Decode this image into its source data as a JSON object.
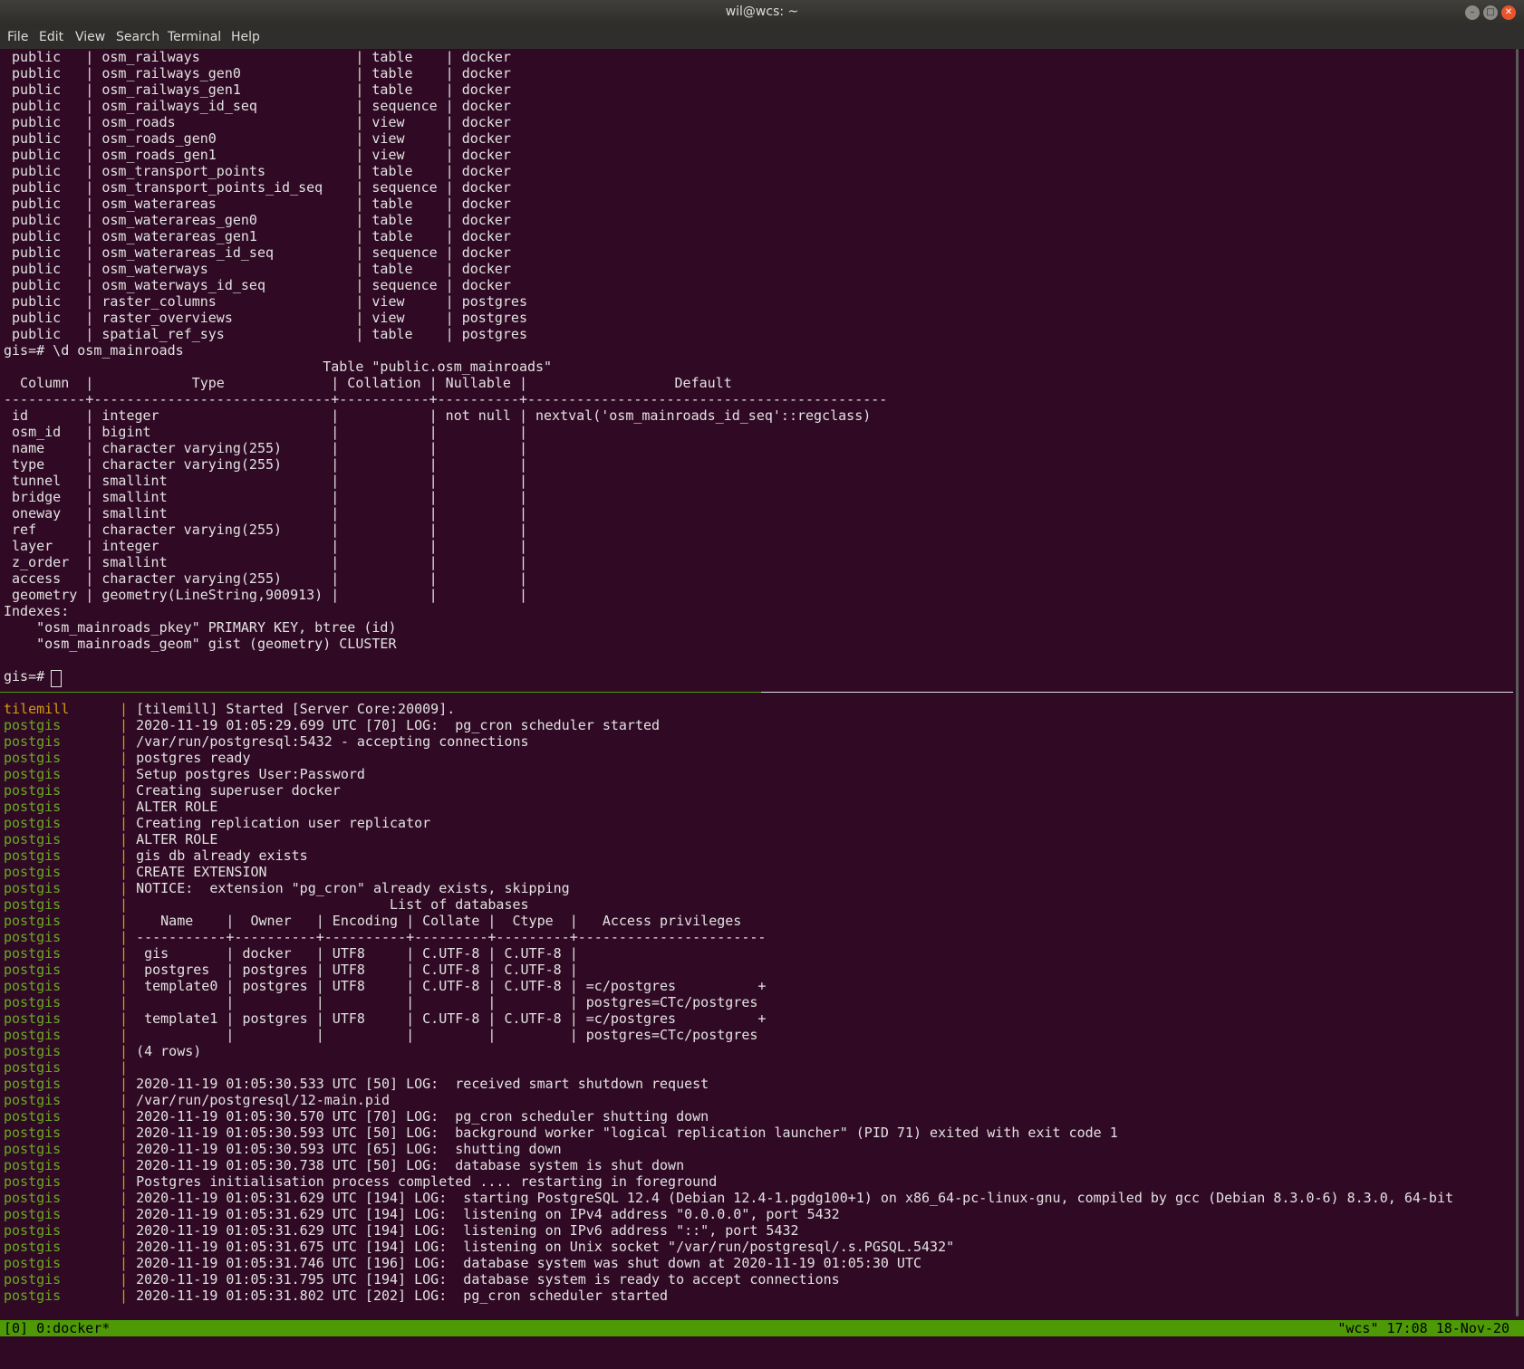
{
  "window": {
    "title": "wil@wcs: ~"
  },
  "menu": [
    "File",
    "Edit",
    "View",
    "Search",
    "Terminal",
    "Help"
  ],
  "top_pane": {
    "lines": [
      " public   | osm_railways                   | table    | docker",
      " public   | osm_railways_gen0              | table    | docker",
      " public   | osm_railways_gen1              | table    | docker",
      " public   | osm_railways_id_seq            | sequence | docker",
      " public   | osm_roads                      | view     | docker",
      " public   | osm_roads_gen0                 | view     | docker",
      " public   | osm_roads_gen1                 | view     | docker",
      " public   | osm_transport_points           | table    | docker",
      " public   | osm_transport_points_id_seq    | sequence | docker",
      " public   | osm_waterareas                 | table    | docker",
      " public   | osm_waterareas_gen0            | table    | docker",
      " public   | osm_waterareas_gen1            | table    | docker",
      " public   | osm_waterareas_id_seq          | sequence | docker",
      " public   | osm_waterways                  | table    | docker",
      " public   | osm_waterways_id_seq           | sequence | docker",
      " public   | raster_columns                 | view     | postgres",
      " public   | raster_overviews               | view     | postgres",
      " public   | spatial_ref_sys                | table    | postgres",
      "gis=# \\d osm_mainroads",
      "                                       Table \"public.osm_mainroads\"",
      "  Column  |            Type             | Collation | Nullable |                  Default",
      "----------+-----------------------------+-----------+----------+--------------------------------------------",
      " id       | integer                     |           | not null | nextval('osm_mainroads_id_seq'::regclass)",
      " osm_id   | bigint                      |           |          |",
      " name     | character varying(255)      |           |          |",
      " type     | character varying(255)      |           |          |",
      " tunnel   | smallint                    |           |          |",
      " bridge   | smallint                    |           |          |",
      " oneway   | smallint                    |           |          |",
      " ref      | character varying(255)      |           |          |",
      " layer    | integer                     |           |          |",
      " z_order  | smallint                    |           |          |",
      " access   | character varying(255)      |           |          |",
      " geometry | geometry(LineString,900913) |           |          |",
      "Indexes:",
      "    \"osm_mainroads_pkey\" PRIMARY KEY, btree (id)",
      "    \"osm_mainroads_geom\" gist (geometry) CLUSTER",
      "",
      "gis=# "
    ]
  },
  "bottom_pane": {
    "lines": [
      {
        "src": "tilemill",
        "msg": "[tilemill] Started [Server Core:20009]."
      },
      {
        "src": "postgis",
        "msg": "2020-11-19 01:05:29.699 UTC [70] LOG:  pg_cron scheduler started"
      },
      {
        "src": "postgis",
        "msg": "/var/run/postgresql:5432 - accepting connections"
      },
      {
        "src": "postgis",
        "msg": "postgres ready"
      },
      {
        "src": "postgis",
        "msg": "Setup postgres User:Password"
      },
      {
        "src": "postgis",
        "msg": "Creating superuser docker"
      },
      {
        "src": "postgis",
        "msg": "ALTER ROLE"
      },
      {
        "src": "postgis",
        "msg": "Creating replication user replicator"
      },
      {
        "src": "postgis",
        "msg": "ALTER ROLE"
      },
      {
        "src": "postgis",
        "msg": "gis db already exists"
      },
      {
        "src": "postgis",
        "msg": "CREATE EXTENSION"
      },
      {
        "src": "postgis",
        "msg": "NOTICE:  extension \"pg_cron\" already exists, skipping"
      },
      {
        "src": "postgis",
        "msg": "                               List of databases"
      },
      {
        "src": "postgis",
        "msg": "   Name    |  Owner   | Encoding | Collate |  Ctype  |   Access privileges"
      },
      {
        "src": "postgis",
        "msg": "-----------+----------+----------+---------+---------+-----------------------"
      },
      {
        "src": "postgis",
        "msg": " gis       | docker   | UTF8     | C.UTF-8 | C.UTF-8 |"
      },
      {
        "src": "postgis",
        "msg": " postgres  | postgres | UTF8     | C.UTF-8 | C.UTF-8 |"
      },
      {
        "src": "postgis",
        "msg": " template0 | postgres | UTF8     | C.UTF-8 | C.UTF-8 | =c/postgres          +"
      },
      {
        "src": "postgis",
        "msg": "           |          |          |         |         | postgres=CTc/postgres"
      },
      {
        "src": "postgis",
        "msg": " template1 | postgres | UTF8     | C.UTF-8 | C.UTF-8 | =c/postgres          +"
      },
      {
        "src": "postgis",
        "msg": "           |          |          |         |         | postgres=CTc/postgres"
      },
      {
        "src": "postgis",
        "msg": "(4 rows)"
      },
      {
        "src": "postgis",
        "msg": ""
      },
      {
        "src": "postgis",
        "msg": "2020-11-19 01:05:30.533 UTC [50] LOG:  received smart shutdown request"
      },
      {
        "src": "postgis",
        "msg": "/var/run/postgresql/12-main.pid"
      },
      {
        "src": "postgis",
        "msg": "2020-11-19 01:05:30.570 UTC [70] LOG:  pg_cron scheduler shutting down"
      },
      {
        "src": "postgis",
        "msg": "2020-11-19 01:05:30.593 UTC [50] LOG:  background worker \"logical replication launcher\" (PID 71) exited with exit code 1"
      },
      {
        "src": "postgis",
        "msg": "2020-11-19 01:05:30.593 UTC [65] LOG:  shutting down"
      },
      {
        "src": "postgis",
        "msg": "2020-11-19 01:05:30.738 UTC [50] LOG:  database system is shut down"
      },
      {
        "src": "postgis",
        "msg": "Postgres initialisation process completed .... restarting in foreground"
      },
      {
        "src": "postgis",
        "msg": "2020-11-19 01:05:31.629 UTC [194] LOG:  starting PostgreSQL 12.4 (Debian 12.4-1.pgdg100+1) on x86_64-pc-linux-gnu, compiled by gcc (Debian 8.3.0-6) 8.3.0, 64-bit"
      },
      {
        "src": "postgis",
        "msg": "2020-11-19 01:05:31.629 UTC [194] LOG:  listening on IPv4 address \"0.0.0.0\", port 5432"
      },
      {
        "src": "postgis",
        "msg": "2020-11-19 01:05:31.629 UTC [194] LOG:  listening on IPv6 address \"::\", port 5432"
      },
      {
        "src": "postgis",
        "msg": "2020-11-19 01:05:31.675 UTC [194] LOG:  listening on Unix socket \"/var/run/postgresql/.s.PGSQL.5432\""
      },
      {
        "src": "postgis",
        "msg": "2020-11-19 01:05:31.746 UTC [196] LOG:  database system was shut down at 2020-11-19 01:05:30 UTC"
      },
      {
        "src": "postgis",
        "msg": "2020-11-19 01:05:31.795 UTC [194] LOG:  database system is ready to accept connections"
      },
      {
        "src": "postgis",
        "msg": "2020-11-19 01:05:31.802 UTC [202] LOG:  pg_cron scheduler started"
      }
    ]
  },
  "statusbar": {
    "left": "[0] 0:docker*",
    "right": "\"wcs\" 17:08 18-Nov-20"
  },
  "colors": {
    "background": "#300a24",
    "text": "#e2e2e2",
    "tilemill": "#d59b0f",
    "postgis": "#6aa823",
    "statusbar": "#4e9a06"
  }
}
